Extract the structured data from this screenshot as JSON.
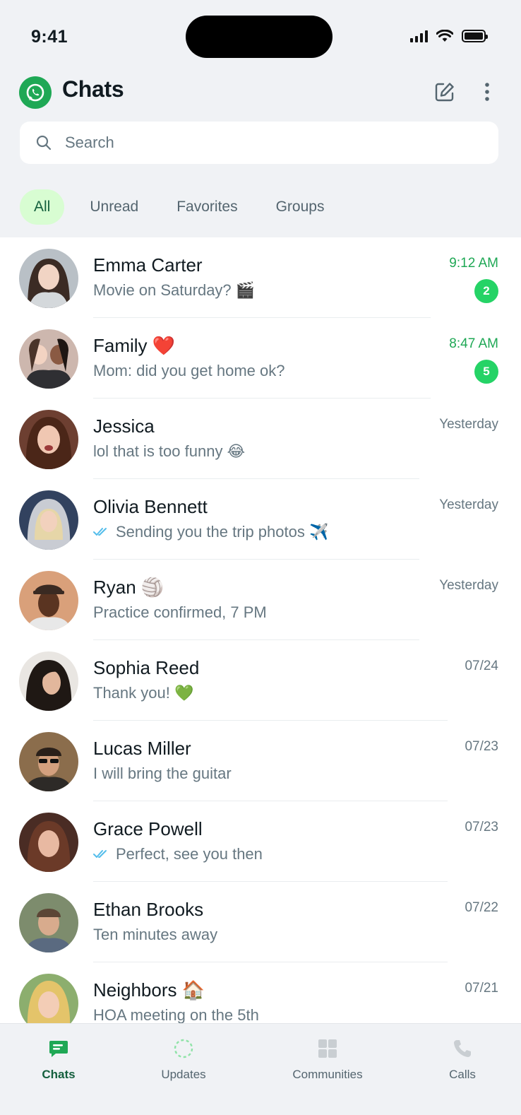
{
  "status_bar": {
    "time": "9:41"
  },
  "header": {
    "title": "Chats"
  },
  "search": {
    "placeholder": "Search"
  },
  "filters": [
    {
      "label": "All",
      "active": true
    },
    {
      "label": "Unread",
      "active": false
    },
    {
      "label": "Favorites",
      "active": false
    },
    {
      "label": "Groups",
      "active": false
    }
  ],
  "chats": [
    {
      "name": "Emma Carter",
      "preview": "Movie on Saturday? 🎬",
      "time": "9:12 AM",
      "unread": "2",
      "read_ticks": false
    },
    {
      "name": "Family ❤️",
      "preview": "Mom: did you get home ok?",
      "time": "8:47 AM",
      "unread": "5",
      "read_ticks": false
    },
    {
      "name": "Jessica",
      "preview": "lol that is too funny 😂",
      "time": "Yesterday",
      "unread": "",
      "read_ticks": false
    },
    {
      "name": "Olivia Bennett",
      "preview": "Sending you the trip photos ✈️",
      "time": "Yesterday",
      "unread": "",
      "read_ticks": true
    },
    {
      "name": "Ryan 🏐",
      "preview": "Practice confirmed, 7 PM",
      "time": "Yesterday",
      "unread": "",
      "read_ticks": false
    },
    {
      "name": "Sophia Reed",
      "preview": "Thank you! 💚",
      "time": "07/24",
      "unread": "",
      "read_ticks": false
    },
    {
      "name": "Lucas Miller",
      "preview": "I will bring the guitar",
      "time": "07/23",
      "unread": "",
      "read_ticks": false
    },
    {
      "name": "Grace Powell",
      "preview": "Perfect, see you then",
      "time": "07/23",
      "unread": "",
      "read_ticks": true
    },
    {
      "name": "Ethan Brooks",
      "preview": "Ten minutes away",
      "time": "07/22",
      "unread": "",
      "read_ticks": false
    },
    {
      "name": "Neighbors 🏠",
      "preview": "HOA meeting on the 5th",
      "time": "07/21",
      "unread": "",
      "read_ticks": false
    }
  ],
  "bottom_nav": [
    {
      "label": "Chats",
      "icon": "chat-bubble-icon",
      "active": true
    },
    {
      "label": "Updates",
      "icon": "status-ring-icon",
      "active": false
    },
    {
      "label": "Communities",
      "icon": "communities-grid-icon",
      "active": false
    },
    {
      "label": "Calls",
      "icon": "phone-icon",
      "active": false
    }
  ],
  "colors": {
    "accent": "#1fa855",
    "badge": "#25d366",
    "active_chip_bg": "#d8fdd2",
    "active_text": "#15603e",
    "ticks": "#53bdeb"
  }
}
